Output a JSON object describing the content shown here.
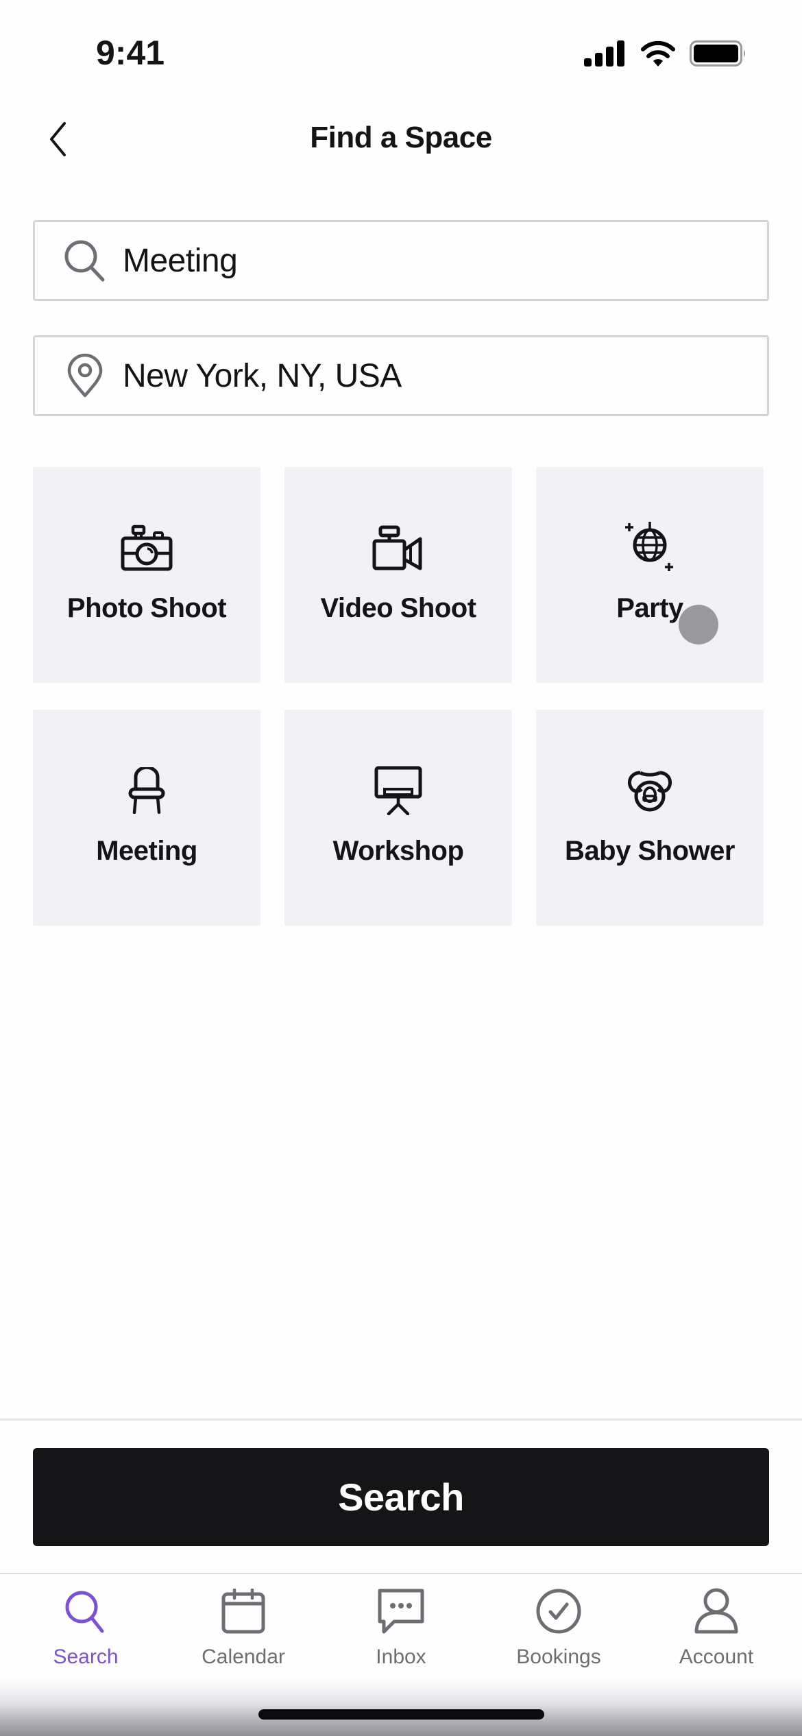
{
  "status_bar": {
    "time": "9:41",
    "icons": [
      "cellular-signal-icon",
      "wifi-icon",
      "battery-icon"
    ]
  },
  "header": {
    "back_icon": "chevron-left-icon",
    "title": "Find a Space"
  },
  "search": {
    "query_icon": "search-icon",
    "query_value": "Meeting",
    "location_icon": "location-pin-icon",
    "location_value": "New York, NY, USA"
  },
  "categories": [
    {
      "label": "Photo Shoot",
      "icon": "camera-icon"
    },
    {
      "label": "Video Shoot",
      "icon": "video-camera-icon"
    },
    {
      "label": "Party",
      "icon": "disco-ball-icon"
    },
    {
      "label": "Meeting",
      "icon": "chair-icon"
    },
    {
      "label": "Workshop",
      "icon": "presentation-board-icon"
    },
    {
      "label": "Baby Shower",
      "icon": "pacifier-icon"
    }
  ],
  "actions": {
    "search_label": "Search"
  },
  "tabbar": {
    "active": "Search",
    "items": [
      {
        "label": "Search",
        "icon": "search-icon"
      },
      {
        "label": "Calendar",
        "icon": "calendar-icon"
      },
      {
        "label": "Inbox",
        "icon": "chat-bubble-icon"
      },
      {
        "label": "Bookings",
        "icon": "check-circle-icon"
      },
      {
        "label": "Account",
        "icon": "person-icon"
      }
    ]
  },
  "colors": {
    "accent": "#7B52D6",
    "tile_bg": "#F2F2F6",
    "primary_button": "#151417",
    "inactive_tab": "#6E6D73"
  }
}
